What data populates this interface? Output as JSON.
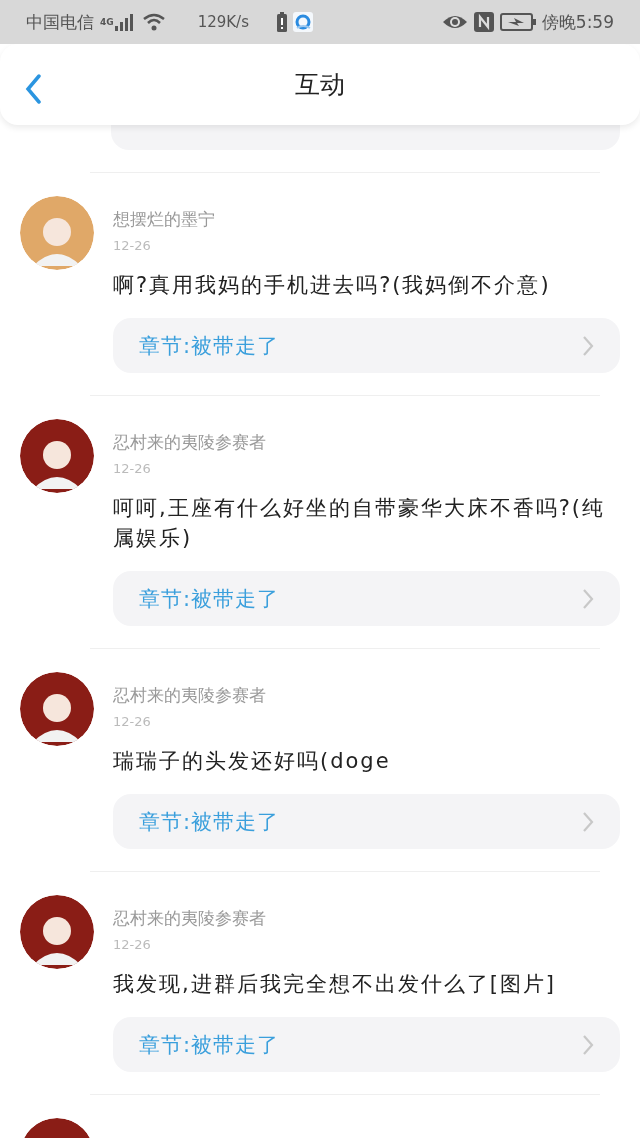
{
  "status_bar": {
    "carrier": "中国电信",
    "network": "4G",
    "speed": "129K/s",
    "time": "傍晚5:59"
  },
  "header": {
    "title": "互动"
  },
  "comments": [
    {
      "kind": "chapter_only"
    },
    {
      "kind": "full",
      "color": "#e0a868",
      "name": "想摆烂的墨宁",
      "date": "12-26",
      "text": "啊?真用我妈的手机进去吗?(我妈倒不介意)",
      "chapter": "章节:被带走了"
    },
    {
      "kind": "full",
      "color": "#8a1d16",
      "name": "忍村来的夷陵参赛者",
      "date": "12-26",
      "text": "呵呵,王座有什么好坐的自带豪华大床不香吗?(纯属娱乐)",
      "chapter": "章节:被带走了"
    },
    {
      "kind": "full",
      "color": "#8a1d16",
      "name": "忍村来的夷陵参赛者",
      "date": "12-26",
      "text": "瑞瑞子的头发还好吗(doge",
      "chapter": "章节:被带走了"
    },
    {
      "kind": "full",
      "color": "#8a1d16",
      "name": "忍村来的夷陵参赛者",
      "date": "12-26",
      "text": "我发现,进群后我完全想不出发什么了[图片]",
      "chapter": "章节:被带走了"
    },
    {
      "kind": "avatar_only",
      "color": "#8a1d16"
    }
  ]
}
